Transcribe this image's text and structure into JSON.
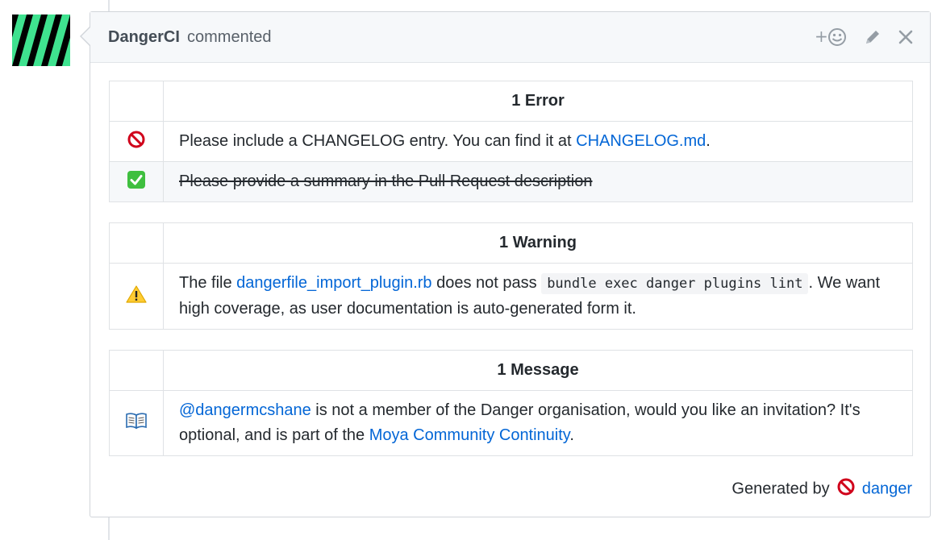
{
  "comment": {
    "author": "DangerCI",
    "action": "commented",
    "header_icons": [
      "add-reaction-icon",
      "pencil-icon",
      "close-icon"
    ]
  },
  "tables": {
    "errors": {
      "header": "1 Error",
      "rows": [
        {
          "icon": "no-entry-icon",
          "text_before": "Please include a CHANGELOG entry. You can find it at ",
          "link": "CHANGELOG.md",
          "text_after": "."
        },
        {
          "icon": "check-mark-icon",
          "text": "Please provide a summary in the Pull Request description",
          "struck": true
        }
      ]
    },
    "warnings": {
      "header": "1 Warning",
      "rows": [
        {
          "icon": "warning-icon",
          "text_before": "The file ",
          "link": "dangerfile_import_plugin.rb",
          "text_mid": " does not pass ",
          "code": "bundle exec danger plugins lint",
          "text_after": ". We want high coverage, as user documentation is auto-generated form it."
        }
      ]
    },
    "messages": {
      "header": "1 Message",
      "rows": [
        {
          "icon": "book-icon",
          "link": "@dangermcshane",
          "text_mid": " is not a member of the Danger organisation, would you like an invitation? It's optional, and is part of the ",
          "link2": "Moya Community Continuity",
          "text_after": "."
        }
      ]
    }
  },
  "footer": {
    "label": "Generated by",
    "icon": "no-entry-icon",
    "link": "danger"
  },
  "colors": {
    "link": "#0366d6",
    "avatar_green": "#3fe28f",
    "error_red": "#d0021b",
    "check_green": "#3fbf3f"
  }
}
